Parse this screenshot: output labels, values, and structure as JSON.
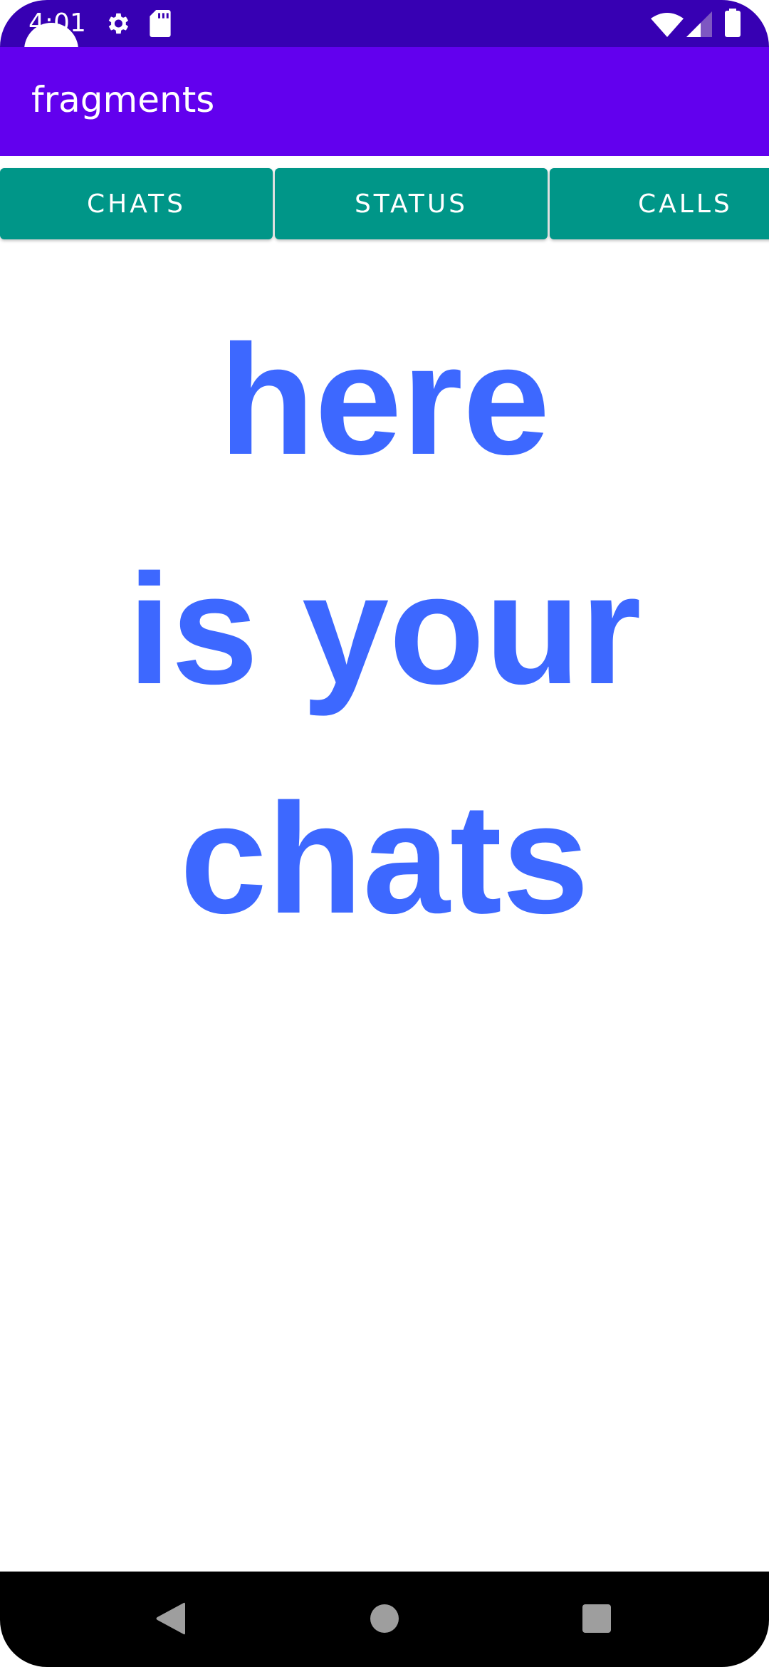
{
  "status_bar": {
    "time": "4:01",
    "icons": [
      "settings-icon",
      "sd-card-icon",
      "wifi-icon",
      "signal-icon",
      "battery-icon"
    ]
  },
  "app_bar": {
    "title": "fragments"
  },
  "tabs": [
    {
      "label": "CHATS"
    },
    {
      "label": "STATUS"
    },
    {
      "label": "CALLS"
    }
  ],
  "content": {
    "lines": [
      "here",
      "is your",
      "chats"
    ],
    "text_color": "#3D68FF"
  },
  "colors": {
    "status_bar": "#3700B3",
    "app_bar": "#6200EE",
    "tab": "#009688"
  },
  "nav_bar": {
    "icons": [
      "back-icon",
      "home-icon",
      "recents-icon"
    ]
  }
}
